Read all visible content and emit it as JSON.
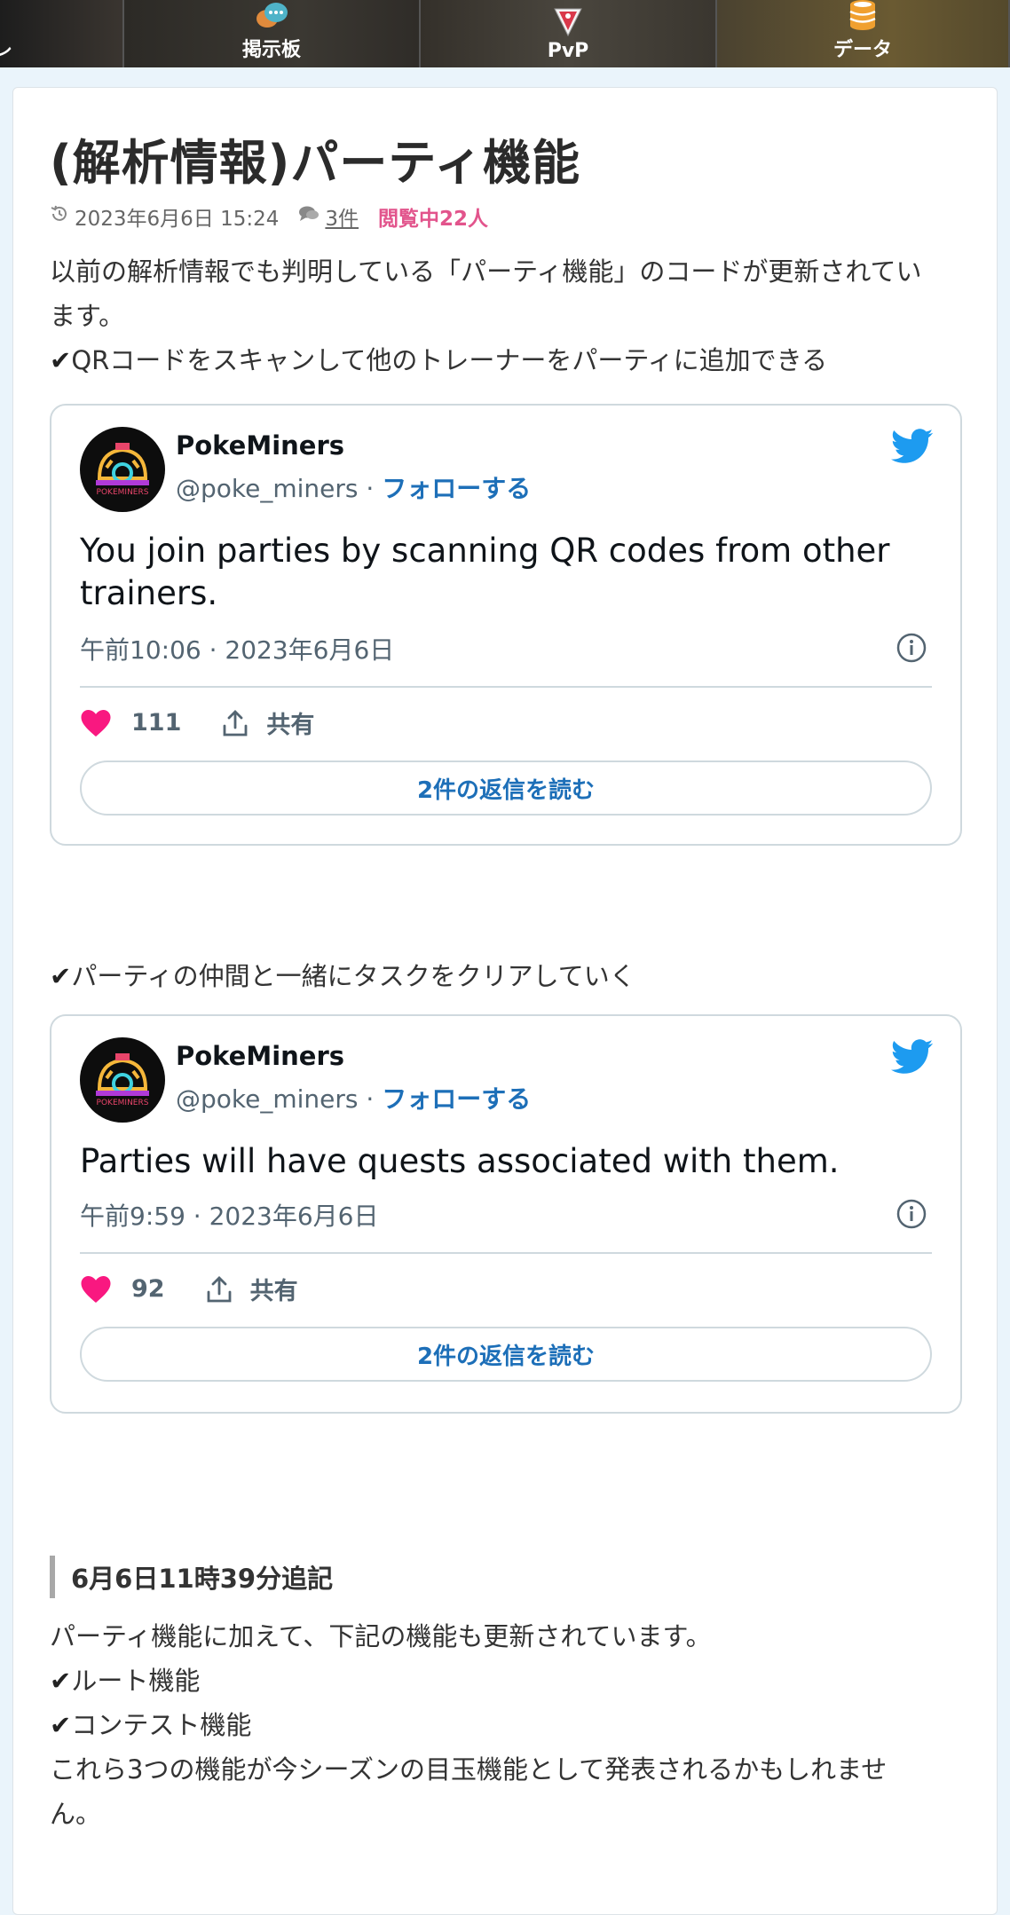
{
  "nav": {
    "left_partial": "レ",
    "board_label": "掲示板",
    "pvp_label": "PvP",
    "data_label": "データ"
  },
  "article": {
    "title": "(解析情報)パーティ機能",
    "date": "2023年6月6日 15:24",
    "comments": "3件",
    "viewing": "閲覧中22人",
    "intro_line1": "以前の解析情報でも判明している「パーティ機能」のコードが更新されてい",
    "intro_line2": "ます。",
    "check1": "QRコードをスキャンして他のトレーナーをパーティに追加できる",
    "check2": "パーティの仲間と一緒にタスクをクリアしていく",
    "addendum_heading": "6月6日11時39分追記",
    "add_line1": "パーティ機能に加えて、下記の機能も更新されています。",
    "add_check1": "ルート機能",
    "add_check2": "コンテスト機能",
    "add_line2": "これら3つの機能が今シーズンの目玉機能として発表されるかもしれませ",
    "add_line3": "ん。"
  },
  "tweets": [
    {
      "name": "PokeMiners",
      "handle": "@poke_miners",
      "follow": "フォローする",
      "text": "You join parties by scanning QR codes from other trainers.",
      "time": "午前10:06 · 2023年6月6日",
      "likes": "111",
      "share": "共有",
      "replies": "2件の返信を読む",
      "avatar_label": "POKEMINERS"
    },
    {
      "name": "PokeMiners",
      "handle": "@poke_miners",
      "follow": "フォローする",
      "text": "Parties will have quests associated with them.",
      "time": "午前9:59 · 2023年6月6日",
      "likes": "92",
      "share": "共有",
      "replies": "2件の返信を読む",
      "avatar_label": "POKEMINERS"
    }
  ],
  "colors": {
    "accent_pink": "#e2548c",
    "twitter_blue": "#1d9bf0",
    "link_blue": "#1d6fb8",
    "heart": "#f91880"
  },
  "icons": {
    "board": "chat-bubbles-icon",
    "pvp": "pvp-shield-icon",
    "data": "database-icon",
    "clock": "history-clock-icon",
    "comment": "comment-icon",
    "bird": "twitter-bird-icon",
    "info": "info-icon",
    "heart": "heart-icon",
    "share": "share-icon"
  }
}
